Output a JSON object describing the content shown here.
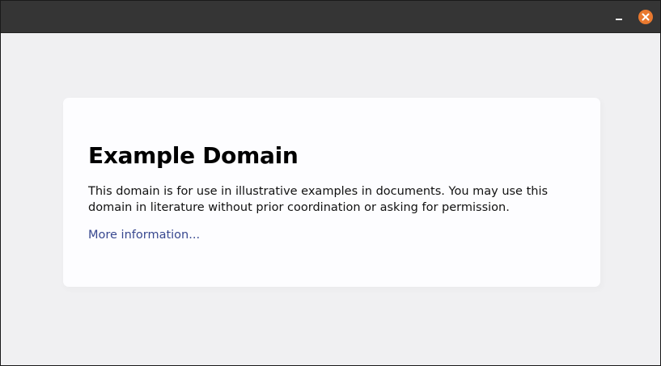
{
  "window": {
    "controls": {
      "minimize_icon": "minimize-icon",
      "close_icon": "close-icon",
      "close_color": "#e9792f"
    }
  },
  "page": {
    "heading": "Example Domain",
    "description": "This domain is for use in illustrative examples in documents. You may use this domain in literature without prior coordination or asking for permission.",
    "link_text": "More information..."
  },
  "colors": {
    "background": "#f0f0f2",
    "card": "#fdfdff",
    "link": "#38488f",
    "titlebar": "#353535"
  }
}
